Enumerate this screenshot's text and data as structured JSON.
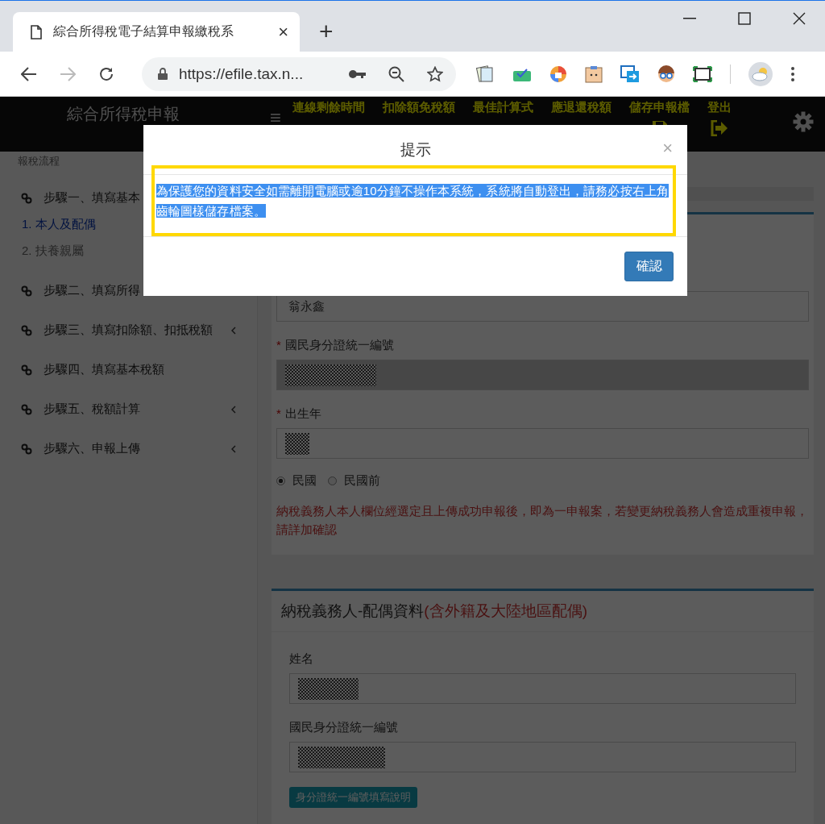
{
  "browser": {
    "tab_title": "綜合所得稅電子結算申報繳稅系",
    "tab_close": "×",
    "new_tab": "+",
    "url": "https://efile.tax.n..."
  },
  "header": {
    "title": "綜合所得稅申報",
    "menu": "≡",
    "nav": [
      {
        "label": "連線剩餘時間",
        "kind": "text"
      },
      {
        "label": "扣除額免稅額",
        "kind": "text"
      },
      {
        "label": "最佳計算式",
        "kind": "text"
      },
      {
        "label": "應退還稅額",
        "kind": "text"
      },
      {
        "label": "儲存申報檔",
        "kind": "save"
      },
      {
        "label": "登出",
        "kind": "logout"
      }
    ]
  },
  "sidebar": {
    "heading": "報稅流程",
    "steps": [
      {
        "label": "步驟一、填寫基本",
        "children": [
          {
            "label": "1. 本人及配偶",
            "selected": true
          },
          {
            "label": "2. 扶養親屬",
            "selected": false
          }
        ]
      },
      {
        "label": "步驟二、填寫所得"
      },
      {
        "label": "步驟三、填寫扣除額、扣抵稅額",
        "collapsible": true
      },
      {
        "label": "步驟四、填寫基本稅額",
        "collapsible": false
      },
      {
        "label": "步驟五、稅額計算",
        "collapsible": true
      },
      {
        "label": "步驟六、申報上傳",
        "collapsible": true
      }
    ]
  },
  "taxpayer": {
    "fields": [
      {
        "kind": "text",
        "value": "翁永鑫",
        "disabled": false
      },
      {
        "kind": "masked",
        "mark": "*",
        "label": "國民身分證統一編號",
        "disabled": true
      },
      {
        "kind": "masked",
        "mark": "*",
        "label": "出生年",
        "disabled": false
      }
    ],
    "era_options": [
      {
        "label": "民國",
        "selected": true
      },
      {
        "label": "民國前",
        "selected": false
      }
    ],
    "note": "納稅義務人本人欄位經選定且上傳成功申報後，即為一申報案，若變更納稅義務人會造成重複申報，請詳加確認"
  },
  "spouse": {
    "title": "納稅義務人-配偶資料",
    "title_note": "(含外籍及大陸地區配偶)",
    "fields": [
      {
        "kind": "masked",
        "label": "姓名",
        "disabled": false
      },
      {
        "kind": "masked",
        "label": "國民身分證統一編號",
        "disabled": false
      }
    ],
    "help_button": "身分證統一編號填寫說明"
  },
  "modal": {
    "title": "提示",
    "close": "×",
    "message": "為保護您的資料安全如需離開電腦或逾10分鐘不操作本系統，系統將自動登出，請務必按右上角齒輪圖樣儲存檔案。",
    "message_selected": true,
    "confirm": "確認"
  }
}
